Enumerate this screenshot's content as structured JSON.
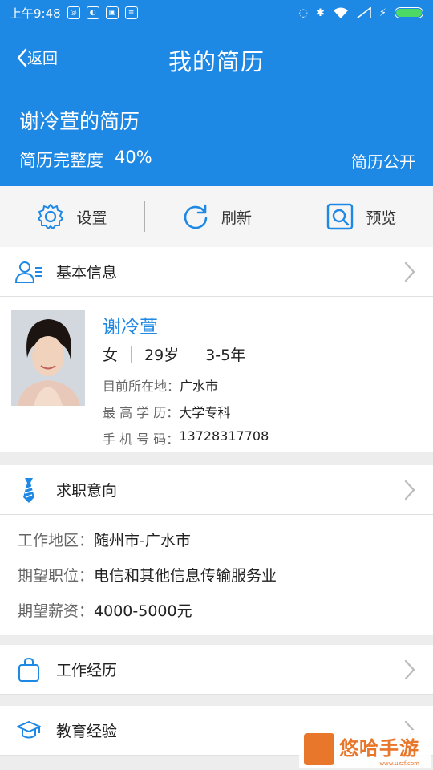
{
  "status_bar": {
    "time": "上午9:48"
  },
  "nav": {
    "back_label": "返回",
    "title": "我的简历"
  },
  "resume": {
    "name_title": "谢冷萱的简历",
    "completeness_label": "简历完整度",
    "completeness_value": "40%",
    "completeness_fraction": 0.4,
    "public_label": "简历公开"
  },
  "actions": [
    {
      "icon": "gear-icon",
      "label": "设置"
    },
    {
      "icon": "refresh-icon",
      "label": "刷新"
    },
    {
      "icon": "preview-search-icon",
      "label": "预览"
    }
  ],
  "basic_info": {
    "section_title": "基本信息",
    "name": "谢冷萱",
    "gender": "女",
    "age": "29岁",
    "experience": "3-5年",
    "location_label": "目前所在地：",
    "location_value": "广水市",
    "education_label": "最 高 学 历：",
    "education_value": "大学专科",
    "phone_label": "手 机 号 码：",
    "phone_value": "13728317708"
  },
  "job_intent": {
    "section_title": "求职意向",
    "area_label": "工作地区：",
    "area_value": "随州市-广水市",
    "position_label": "期望职位：",
    "position_value": "电信和其他信息传输服务业",
    "salary_label": "期望薪资：",
    "salary_value": "4000-5000元"
  },
  "work_experience": {
    "section_title": "工作经历"
  },
  "education": {
    "section_title": "教育经验"
  },
  "watermark": {
    "main": "悠哈手游",
    "sub": "www.uzzf.com"
  },
  "colors": {
    "primary": "#1e88e5",
    "background": "#ededed"
  }
}
